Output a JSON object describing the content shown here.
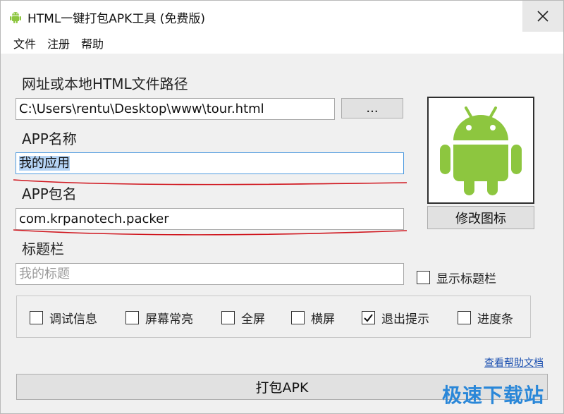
{
  "window": {
    "title": "HTML一键打包APK工具 (免费版)",
    "close_glyph": "✕"
  },
  "menu": [
    "文件",
    "注册",
    "帮助"
  ],
  "form": {
    "url_label": "网址或本地HTML文件路径",
    "url_value": "C:\\Users\\rentu\\Desktop\\www\\tour.html",
    "browse_label": "...",
    "app_name_label": "APP名称",
    "app_name_value": "我的应用",
    "package_label": "APP包名",
    "package_value": "com.krpanotech.packer",
    "titlebar_label": "标题栏",
    "titlebar_placeholder": "我的标题",
    "show_titlebar_label": "显示标题栏",
    "show_titlebar_checked": false
  },
  "icon_panel": {
    "icon": "android-robot-icon",
    "icon_color": "#8dc63f",
    "change_icon_label": "修改图标"
  },
  "options": [
    {
      "label": "调试信息",
      "checked": false
    },
    {
      "label": "屏幕常亮",
      "checked": false
    },
    {
      "label": "全屏",
      "checked": false
    },
    {
      "label": "横屏",
      "checked": false
    },
    {
      "label": "退出提示",
      "checked": true
    },
    {
      "label": "进度条",
      "checked": false
    }
  ],
  "help_link": "查看帮助文档",
  "pack_button": "打包APK",
  "watermark": "极速下载站",
  "annotation_color": "#d0161e"
}
